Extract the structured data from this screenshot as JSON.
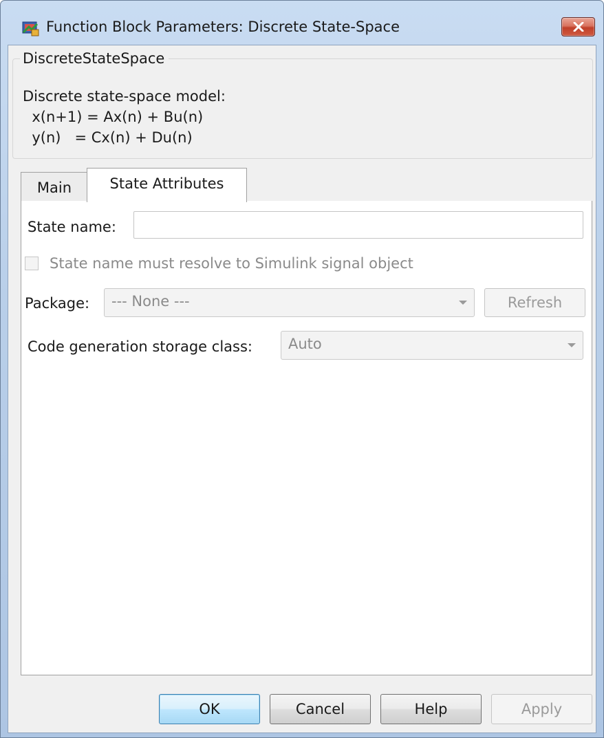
{
  "window": {
    "title": "Function Block Parameters: Discrete State-Space"
  },
  "block": {
    "group_title": "DiscreteStateSpace",
    "description": [
      "Discrete state-space model:",
      "  x(n+1) = Ax(n) + Bu(n)",
      "  y(n)   = Cx(n) + Du(n)"
    ]
  },
  "tabs": [
    {
      "label": "Main",
      "selected": false
    },
    {
      "label": "State Attributes",
      "selected": true
    }
  ],
  "state_attributes": {
    "state_name_label": "State name:",
    "state_name_value": "",
    "resolve_checkbox_label": "State name must resolve to Simulink signal object",
    "resolve_checkbox_checked": false,
    "package_label": "Package:",
    "package_value": "--- None ---",
    "refresh_label": "Refresh",
    "storage_class_label": "Code generation storage class:",
    "storage_class_value": "Auto"
  },
  "buttons": {
    "ok": "OK",
    "cancel": "Cancel",
    "help": "Help",
    "apply": "Apply"
  }
}
